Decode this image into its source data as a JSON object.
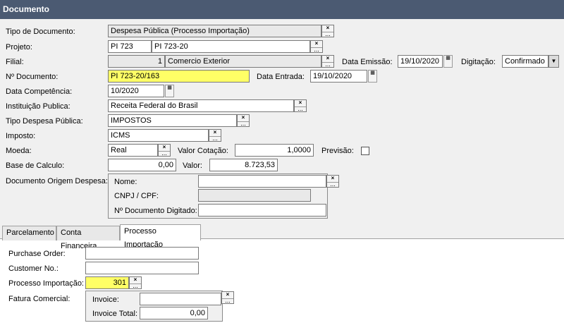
{
  "window": {
    "title": "Documento"
  },
  "form": {
    "tipo_documento": {
      "label": "Tipo de Documento:",
      "value": "Despesa Pública (Processo Importação)"
    },
    "projeto": {
      "label": "Projeto:",
      "code": "PI 723",
      "name": "PI 723-20"
    },
    "filial": {
      "label": "Filial:",
      "code": "1",
      "name": "Comercio Exterior"
    },
    "data_emissao": {
      "label": "Data Emissão:",
      "value": "19/10/2020"
    },
    "digitacao": {
      "label": "Digitação:",
      "value": "Confirmado"
    },
    "numero_documento": {
      "label": "Nº Documento:",
      "value": "PI 723-20/163"
    },
    "data_entrada": {
      "label": "Data Entrada:",
      "value": "19/10/2020"
    },
    "data_competencia": {
      "label": "Data Competência:",
      "value": "10/2020"
    },
    "instituicao_publica": {
      "label": "Instituição Publica:",
      "value": "Receita Federal do Brasil"
    },
    "tipo_despesa_publica": {
      "label": "Tipo Despesa Pública:",
      "value": "IMPOSTOS"
    },
    "imposto": {
      "label": "Imposto:",
      "value": "ICMS"
    },
    "moeda": {
      "label": "Moeda:",
      "value": "Real"
    },
    "valor_cotacao": {
      "label": "Valor Cotação:",
      "value": "1,0000"
    },
    "previsao": {
      "label": "Previsão:",
      "checked": false
    },
    "base_calculo": {
      "label": "Base de Calculo:",
      "value": "0,00"
    },
    "valor": {
      "label": "Valor:",
      "value": "8.723,53"
    },
    "documento_origem": {
      "label": "Documento Origem Despesa:",
      "nome_label": "Nome:",
      "nome_value": "",
      "cnpj_label": "CNPJ / CPF:",
      "cnpj_value": "",
      "numero_label": "Nº Documento Digitado:",
      "numero_value": ""
    }
  },
  "tabs": [
    {
      "label": "Parcelamento",
      "active": false
    },
    {
      "label": "Conta Financeira",
      "active": false
    },
    {
      "label": "Processo Importação",
      "active": true
    }
  ],
  "processo_importacao_tab": {
    "purchase_order": {
      "label": "Purchase Order:",
      "value": ""
    },
    "customer_no": {
      "label": "Customer No.:",
      "value": ""
    },
    "processo_importacao": {
      "label": "Processo Importação:",
      "value": "301"
    },
    "fatura_comercial": {
      "label": "Fatura Comercial:",
      "invoice_label": "Invoice:",
      "invoice_value": "",
      "invoice_total_label": "Invoice Total:",
      "invoice_total_value": "0,00"
    }
  },
  "icons": {
    "lookup_clear": "×",
    "lookup_more": "...",
    "calendar": "▦",
    "dropdown": "▼"
  },
  "colors": {
    "title_bar": "#4b5a72",
    "highlight_field": "#ffff66"
  }
}
